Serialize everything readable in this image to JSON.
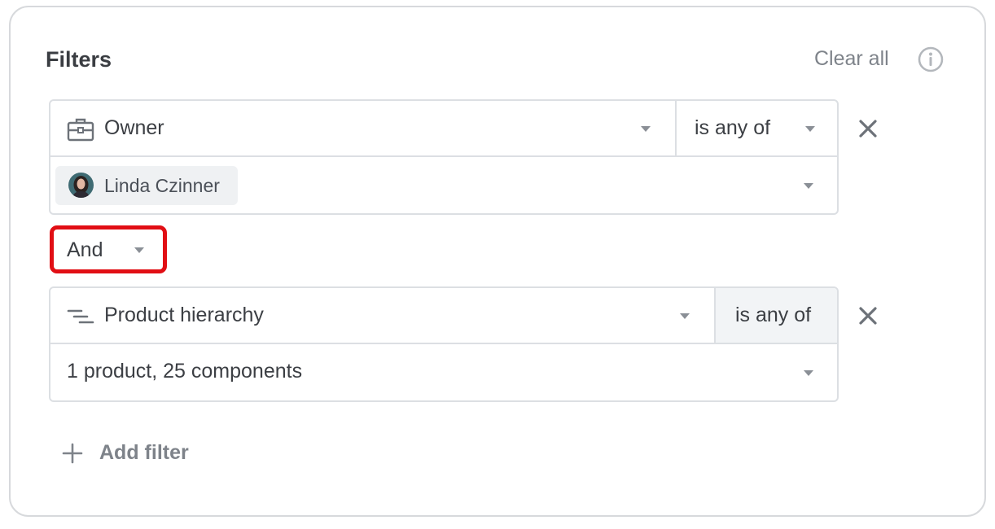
{
  "header": {
    "title": "Filters",
    "clear_all": "Clear all",
    "info_icon": "info-icon"
  },
  "filters": [
    {
      "field": "Owner",
      "field_icon": "briefcase-icon",
      "operator": "is any of",
      "value_chip": "Linda Czinner"
    },
    {
      "field": "Product hierarchy",
      "field_icon": "hierarchy-icon",
      "operator": "is any of",
      "value_text": "1 product, 25 components"
    }
  ],
  "conjunction": "And",
  "add_filter_label": "Add filter",
  "colors": {
    "highlight": "#e10e14",
    "border": "#dcdfe3",
    "muted_text": "#7e838a"
  }
}
